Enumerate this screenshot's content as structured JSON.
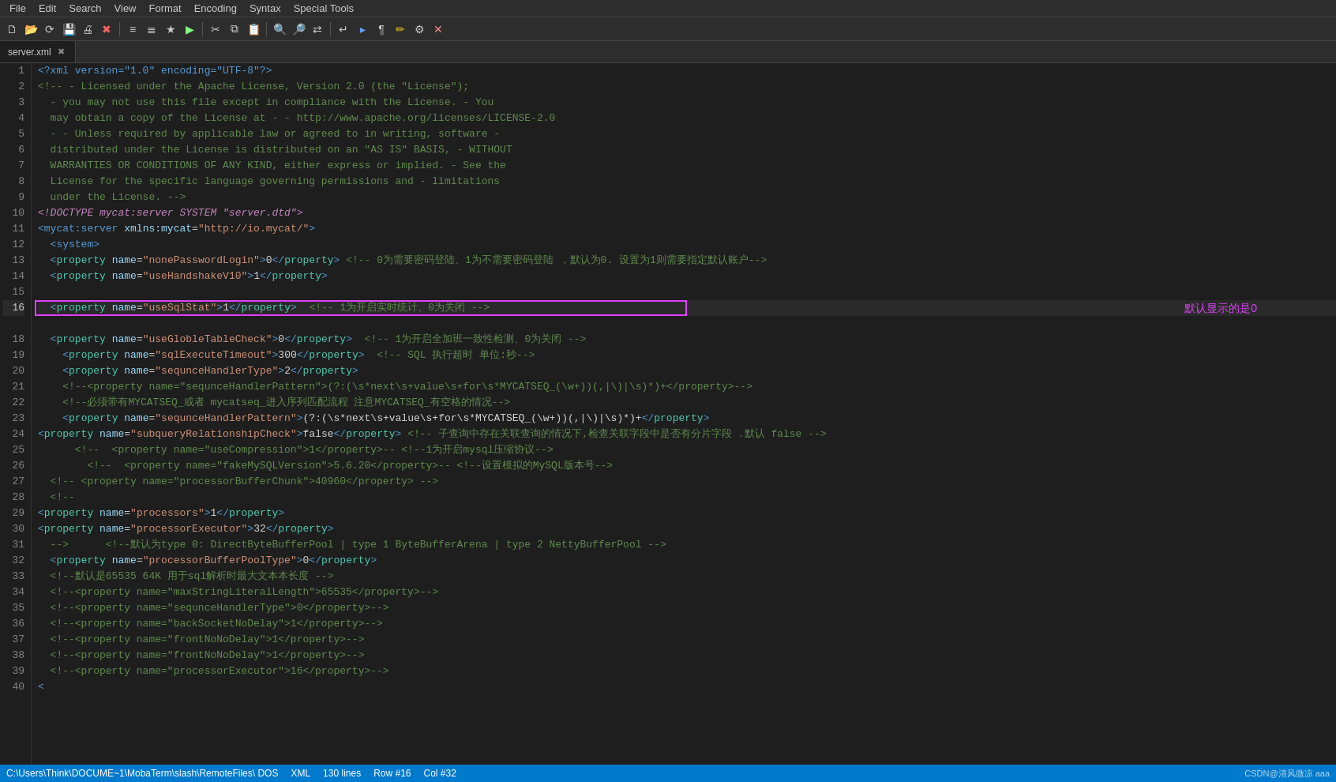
{
  "menu": {
    "items": [
      "File",
      "Edit",
      "Search",
      "View",
      "Format",
      "Encoding",
      "Syntax",
      "Special Tools"
    ]
  },
  "toolbar": {
    "buttons": [
      {
        "name": "new-file-btn",
        "icon": "🗋"
      },
      {
        "name": "open-file-btn",
        "icon": "📂"
      },
      {
        "name": "reload-btn",
        "icon": "↻"
      },
      {
        "name": "save-btn",
        "icon": "💾"
      },
      {
        "name": "print-btn",
        "icon": "🖨"
      },
      {
        "name": "close-btn",
        "icon": "✖"
      },
      {
        "sep": true
      },
      {
        "name": "cut-btn",
        "icon": "✂"
      },
      {
        "name": "copy-btn",
        "icon": "⧉"
      },
      {
        "name": "paste-btn",
        "icon": "📋"
      },
      {
        "sep": true
      },
      {
        "name": "undo-btn",
        "icon": "↩"
      },
      {
        "name": "redo-btn",
        "icon": "↪"
      },
      {
        "sep": true
      },
      {
        "name": "find-btn",
        "icon": "🔍"
      },
      {
        "name": "replace-btn",
        "icon": "🔎"
      }
    ]
  },
  "tabs": [
    {
      "label": "server.xml",
      "active": true
    }
  ],
  "status_bar": {
    "path": "C:\\Users\\Think\\DOCUME~1\\MobaTerm\\slash\\RemoteFiles\\ DOS",
    "language": "XML",
    "lines": "130 lines",
    "row": "Row #16",
    "col": "Col #32",
    "watermark": "CSDN@清风微凉 aaa"
  },
  "code": {
    "annotation_line16": "默认显示的是0"
  }
}
